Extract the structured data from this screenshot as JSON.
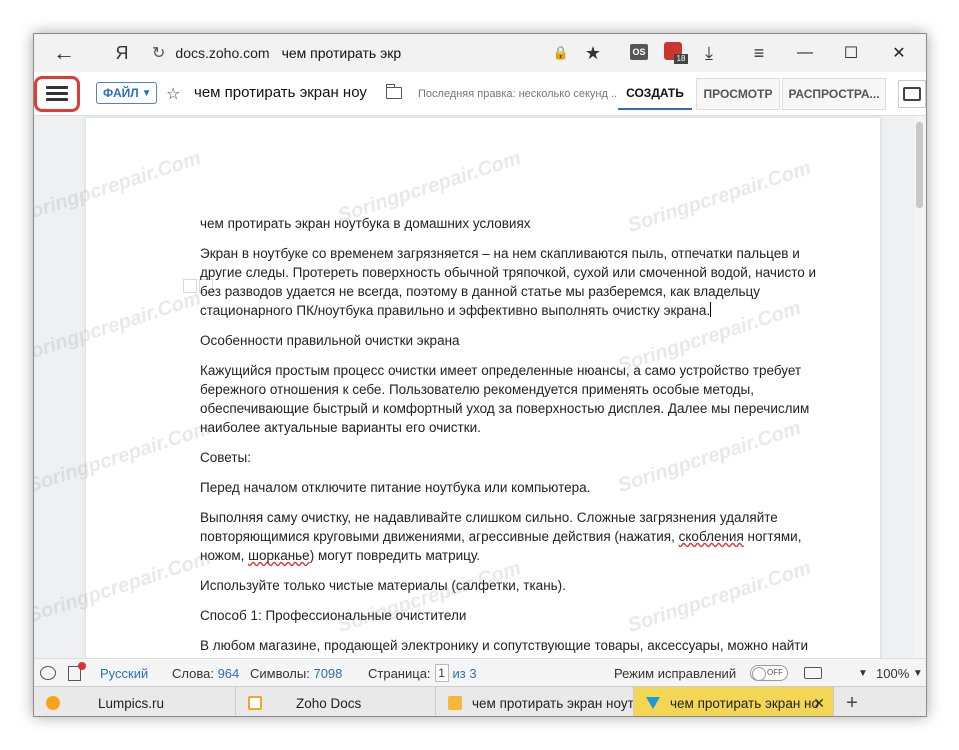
{
  "browser": {
    "back_icon": "arrow-left-icon",
    "yandex_logo": "Я",
    "domain": "docs.zoho.com",
    "page_title": "чем протирать экр",
    "ext_label": "OS",
    "ext_badge": "18"
  },
  "toolbar": {
    "file_label": "ФАЙЛ",
    "doc_title": "чем протирать экран ноу",
    "last_edit": "Последняя правка: несколько секунд ...",
    "tabs": [
      "СОЗДАТЬ",
      "ПРОСМОТР",
      "РАСПРОСТРА..."
    ],
    "active_tab": "СОЗДАТЬ",
    "highlight_color": "#e23b33",
    "accent_color": "#2d6fb7"
  },
  "document": {
    "title_line": "чем протирать экран ноутбука в домашних условиях",
    "p1": "Экран в ноутбуке со временем загрязняется – на нем скапливаются пыль, отпечатки пальцев и другие следы. Протереть поверхность обычной тряпочкой, сухой или смоченной водой, начисто и без разводов удается не всегда, поэтому в данной статье мы разберемся, как владельцу стационарного ПК/ноутбука правильно и эффективно выполнять очистку экрана.",
    "h1": "Особенности правильной очистки экрана",
    "p2": "Кажущийся простым процесс очистки имеет определенные нюансы, а само устройство требует бережного отношения к себе. Пользователю рекомендуется применять особые методы, обеспечивающие быстрый и комфортный уход за поверхностью дисплея. Далее мы перечислим наиболее актуальные варианты его очистки.",
    "tips_label": "Советы:",
    "tip1": "Перед началом отключите питание ноутбука или компьютера.",
    "tip2_a": "Выполняя саму очистку, не надавливайте слишком сильно. Сложные загрязнения удаляйте повторяющимися круговыми движениями, агрессивные действия (нажатия, ",
    "tip2_sq1": "скобления",
    "tip2_b": " ногтями, ножом, ",
    "tip2_sq2": "шорканье",
    "tip2_c": ") могут повредить матрицу.",
    "tip3": "Используйте только чистые материалы (салфетки, ткань).",
    "h2": "Способ 1: Профессиональные очистители",
    "p3": "В любом магазине, продающей электронику и сопутствующие товары, аксессуары, можно найти средство для ухода за поверхностью дисплея. Они бывают в разном исполнении и выбирать"
  },
  "watermark": "Soringpcrepair.Com",
  "status": {
    "language": "Русский",
    "words_label": "Слова:",
    "words": "964",
    "chars_label": "Символы:",
    "chars": "7098",
    "page_label": "Страница:",
    "page_current": "1",
    "page_total": "из 3",
    "track_label": "Режим исправлений",
    "track_state": "OFF",
    "zoom": "100%"
  },
  "tabs_bottom": [
    {
      "label": "Lumpics.ru"
    },
    {
      "label": "Zoho Docs"
    },
    {
      "label": "чем протирать экран ноутб"
    },
    {
      "label": "чем протирать экран но"
    }
  ]
}
